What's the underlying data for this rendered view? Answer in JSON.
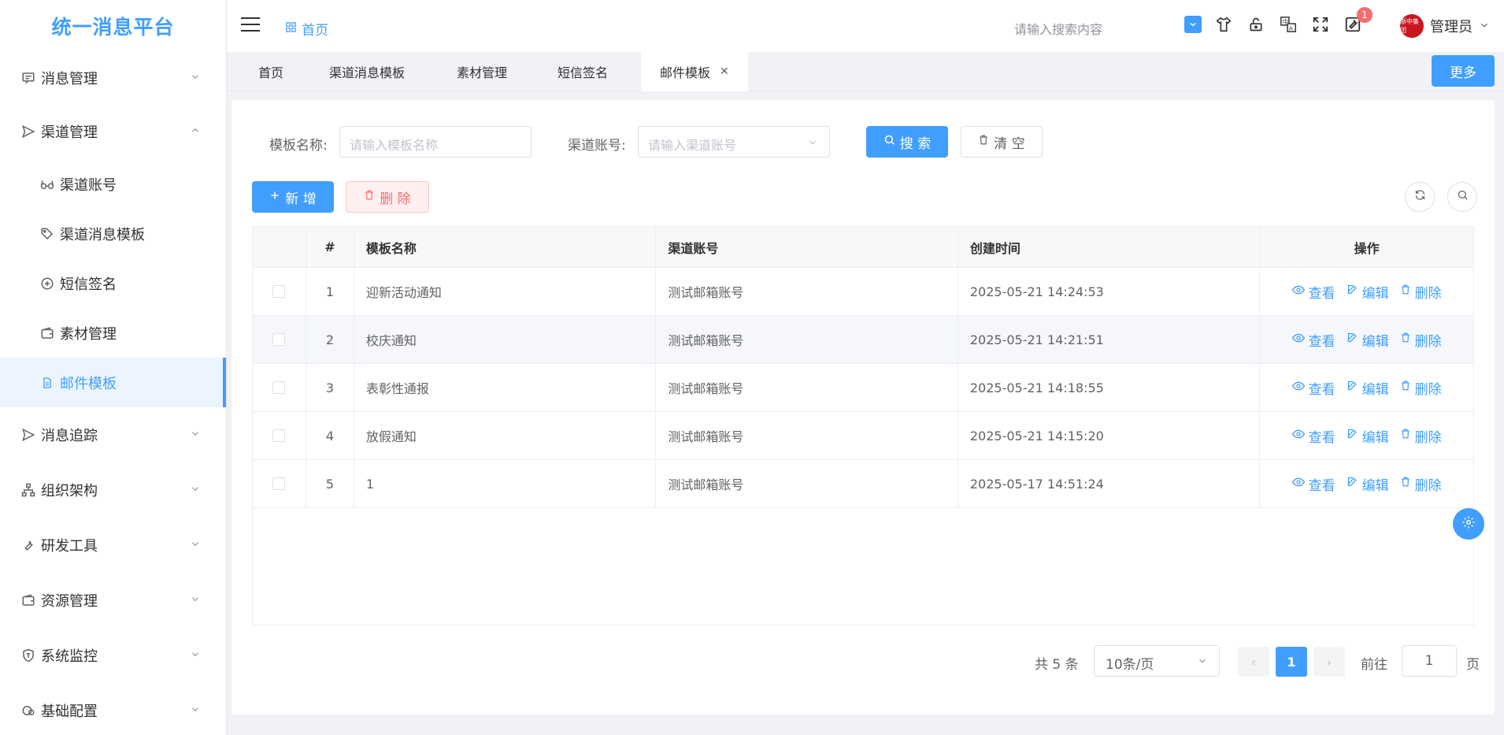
{
  "app": {
    "title": "统一消息平台"
  },
  "sidebar": {
    "menu": [
      {
        "label": "消息管理",
        "icon": "chat-icon",
        "expanded": false
      },
      {
        "label": "渠道管理",
        "icon": "send-icon",
        "expanded": true,
        "children": [
          {
            "label": "渠道账号",
            "icon": "glasses-icon"
          },
          {
            "label": "渠道消息模板",
            "icon": "tag-icon"
          },
          {
            "label": "短信签名",
            "icon": "plus-circle-icon"
          },
          {
            "label": "素材管理",
            "icon": "wallet-icon"
          },
          {
            "label": "邮件模板",
            "icon": "document-icon",
            "active": true
          }
        ]
      },
      {
        "label": "消息追踪",
        "icon": "send-icon",
        "expanded": false
      },
      {
        "label": "组织架构",
        "icon": "org-icon",
        "expanded": false
      },
      {
        "label": "研发工具",
        "icon": "wrench-icon",
        "expanded": false
      },
      {
        "label": "资源管理",
        "icon": "wallet-icon",
        "expanded": false
      },
      {
        "label": "系统监控",
        "icon": "shield-icon",
        "expanded": false
      },
      {
        "label": "基础配置",
        "icon": "config-icon",
        "expanded": false
      }
    ]
  },
  "header": {
    "breadcrumb": "首页",
    "search_placeholder": "请输入搜索内容",
    "notification_count": "1",
    "user_name": "管理员",
    "avatar_text": "浙中集团"
  },
  "tabs": [
    {
      "label": "首页"
    },
    {
      "label": "渠道消息模板"
    },
    {
      "label": "素材管理"
    },
    {
      "label": "短信签名"
    },
    {
      "label": "邮件模板",
      "active": true
    }
  ],
  "tabs_more": "更多",
  "filter": {
    "name_label": "模板名称:",
    "name_placeholder": "请输入模板名称",
    "account_label": "渠道账号:",
    "account_placeholder": "请输入渠道账号",
    "search_btn": "搜 索",
    "clear_btn": "清 空"
  },
  "toolbar": {
    "add_btn": "新 增",
    "delete_btn": "删 除"
  },
  "table": {
    "headers": [
      "",
      "#",
      "模板名称",
      "渠道账号",
      "创建时间",
      "操作"
    ],
    "ops": {
      "view": "查看",
      "edit": "编辑",
      "delete": "删除"
    },
    "rows": [
      {
        "idx": "1",
        "name": "迎新活动通知",
        "account": "测试邮箱账号",
        "created": "2025-05-21 14:24:53"
      },
      {
        "idx": "2",
        "name": "校庆通知",
        "account": "测试邮箱账号",
        "created": "2025-05-21 14:21:51"
      },
      {
        "idx": "3",
        "name": "表彰性通报",
        "account": "测试邮箱账号",
        "created": "2025-05-21 14:18:55"
      },
      {
        "idx": "4",
        "name": "放假通知",
        "account": "测试邮箱账号",
        "created": "2025-05-21 14:15:20"
      },
      {
        "idx": "5",
        "name": "1",
        "account": "测试邮箱账号",
        "created": "2025-05-17 14:51:24"
      }
    ]
  },
  "pagination": {
    "total": "共 5 条",
    "page_size": "10条/页",
    "current": "1",
    "goto_label": "前往",
    "goto_value": "1",
    "page_suffix": "页"
  },
  "colors": {
    "primary": "#409eff",
    "danger": "#f56c6c"
  }
}
